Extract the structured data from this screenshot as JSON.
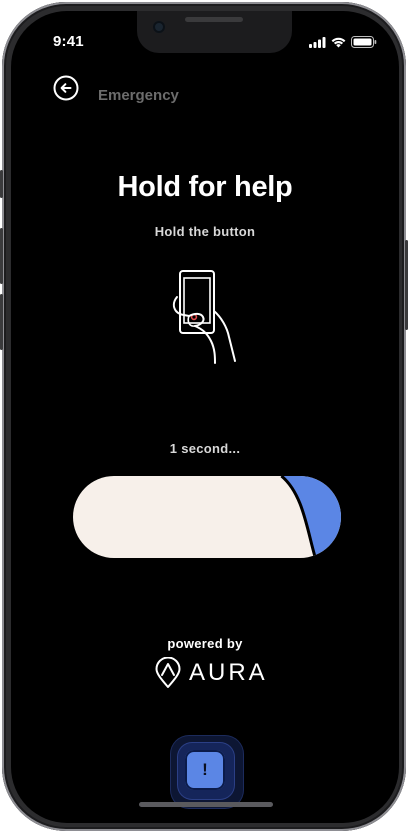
{
  "status_bar": {
    "time": "9:41"
  },
  "header": {
    "back_icon": "arrow-left-circle-icon",
    "title": "Emergency"
  },
  "main": {
    "title": "Hold for help",
    "subtitle": "Hold the button",
    "illustration_icon": "hand-holding-phone-icon",
    "countdown": "1 second...",
    "hold_progress": 0.2
  },
  "footer": {
    "powered_by": "powered by",
    "brand_icon": "aura-logo-icon",
    "brand_name": "AURA"
  },
  "alert_button": {
    "label": "!",
    "icon": "exclamation-icon"
  },
  "colors": {
    "background": "#000000",
    "accent_blue": "#5b86e5",
    "track_fill": "#f7f0ea",
    "muted_text": "#6c6c6c"
  }
}
